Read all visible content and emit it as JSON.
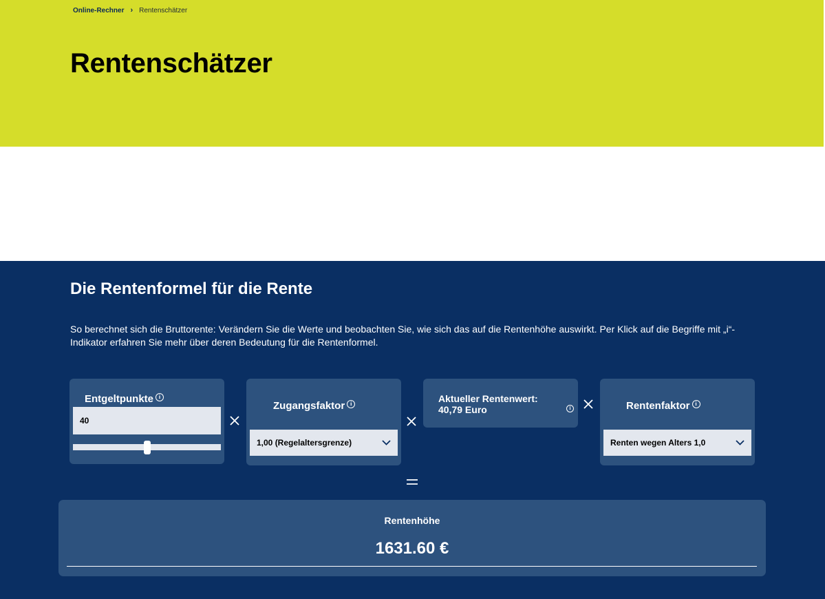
{
  "breadcrumb": {
    "home": "Online-Rechner",
    "separator": "›",
    "current": "Rentenschätzer"
  },
  "page_title": "Rentenschätzer",
  "section": {
    "title": "Die Rentenformel für die Rente",
    "description": "So berechnet sich die Bruttorente: Verändern Sie die Werte und beobachten Sie, wie sich das auf die Rentenhöhe auswirkt. Per Klick auf die Begriffe mit „i“-Indikator erfahren Sie mehr über deren Bedeutung für die Rentenformel."
  },
  "formula": {
    "entgeltpunkte": {
      "label": "Entgeltpunkte",
      "value": "40",
      "slider_fraction": 0.5
    },
    "zugangsfaktor": {
      "label": "Zugangsfaktor",
      "selected": "1,00 (Regelaltersgrenze)"
    },
    "rentenwert": {
      "label_line1": "Aktueller Rentenwert:",
      "label_line2": "40,79 Euro"
    },
    "rentenfaktor": {
      "label": "Rentenfaktor",
      "selected": "Renten wegen Alters 1,0"
    },
    "operators": {
      "times": "×",
      "equals": "="
    }
  },
  "result": {
    "label": "Rentenhöhe",
    "value": "1631.60 €"
  },
  "icons": {
    "info": "info-icon",
    "chevron": "chevron-down-icon"
  },
  "colors": {
    "hero_bg": "#d5dd2a",
    "section_bg": "#0a2f63",
    "card_bg": "#2d527e",
    "input_bg": "#e3e7ee"
  }
}
